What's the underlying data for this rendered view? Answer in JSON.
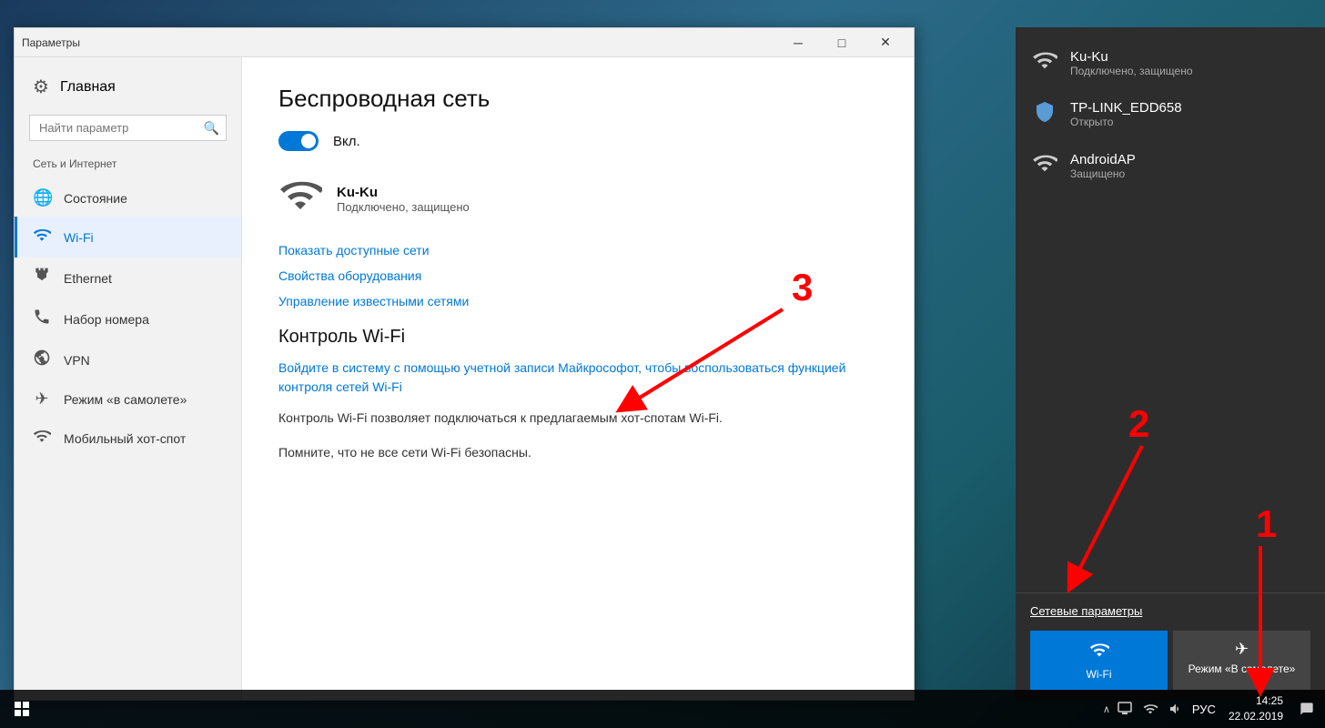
{
  "window": {
    "title": "Параметры",
    "minimize": "─",
    "maximize": "□",
    "close": "✕"
  },
  "sidebar": {
    "home_label": "Главная",
    "search_placeholder": "Найти параметр",
    "section_title": "Сеть и Интернет",
    "items": [
      {
        "id": "status",
        "label": "Состояние",
        "icon": "🌐"
      },
      {
        "id": "wifi",
        "label": "Wi-Fi",
        "icon": "📶",
        "active": true
      },
      {
        "id": "ethernet",
        "label": "Ethernet",
        "icon": "🖥"
      },
      {
        "id": "dialup",
        "label": "Набор номера",
        "icon": "📞"
      },
      {
        "id": "vpn",
        "label": "VPN",
        "icon": "🔗"
      },
      {
        "id": "airplane",
        "label": "Режим «в самолете»",
        "icon": "✈"
      },
      {
        "id": "hotspot",
        "label": "Мобильный хот-спот",
        "icon": "📡"
      }
    ]
  },
  "main": {
    "page_title": "Беспроводная сеть",
    "toggle_label": "Вкл.",
    "network_name": "Ku-Ku",
    "network_status": "Подключено, защищено",
    "link_show_networks": "Показать доступные сети",
    "link_hardware_props": "Свойства оборудования",
    "link_manage_networks": "Управление известными сетями",
    "wifi_control_title": "Контроль Wi-Fi",
    "wifi_control_link": "Войдите в систему с помощью учетной записи Майкрософот, чтобы воспользоваться функцией контроля сетей Wi-Fi",
    "wifi_control_desc": "Контроль Wi-Fi позволяет подключаться к предлагаемым хот-спотам Wi-Fi.",
    "wifi_control_note": "Помните, что не все сети Wi-Fi безопасны."
  },
  "flyout": {
    "networks": [
      {
        "name": "Ku-Ku",
        "status": "Подключено, защищено",
        "icon": "wifi",
        "connected": true
      },
      {
        "name": "TP-LINK_EDD658",
        "status": "Открыто",
        "icon": "shield"
      },
      {
        "name": "AndroidAP",
        "status": "Защищено",
        "icon": "wifi"
      }
    ],
    "settings_link": "Сетевые параметры",
    "quick_actions": [
      {
        "id": "wifi",
        "label": "Wi-Fi",
        "icon": "📶",
        "active": true
      },
      {
        "id": "airplane",
        "label": "Режим «В самолете»",
        "icon": "✈",
        "active": false
      }
    ]
  },
  "taskbar": {
    "time": "14:25",
    "date": "22.02.2019",
    "language": "РУС"
  },
  "numbers": {
    "n1": "1",
    "n2": "2",
    "n3": "3"
  }
}
